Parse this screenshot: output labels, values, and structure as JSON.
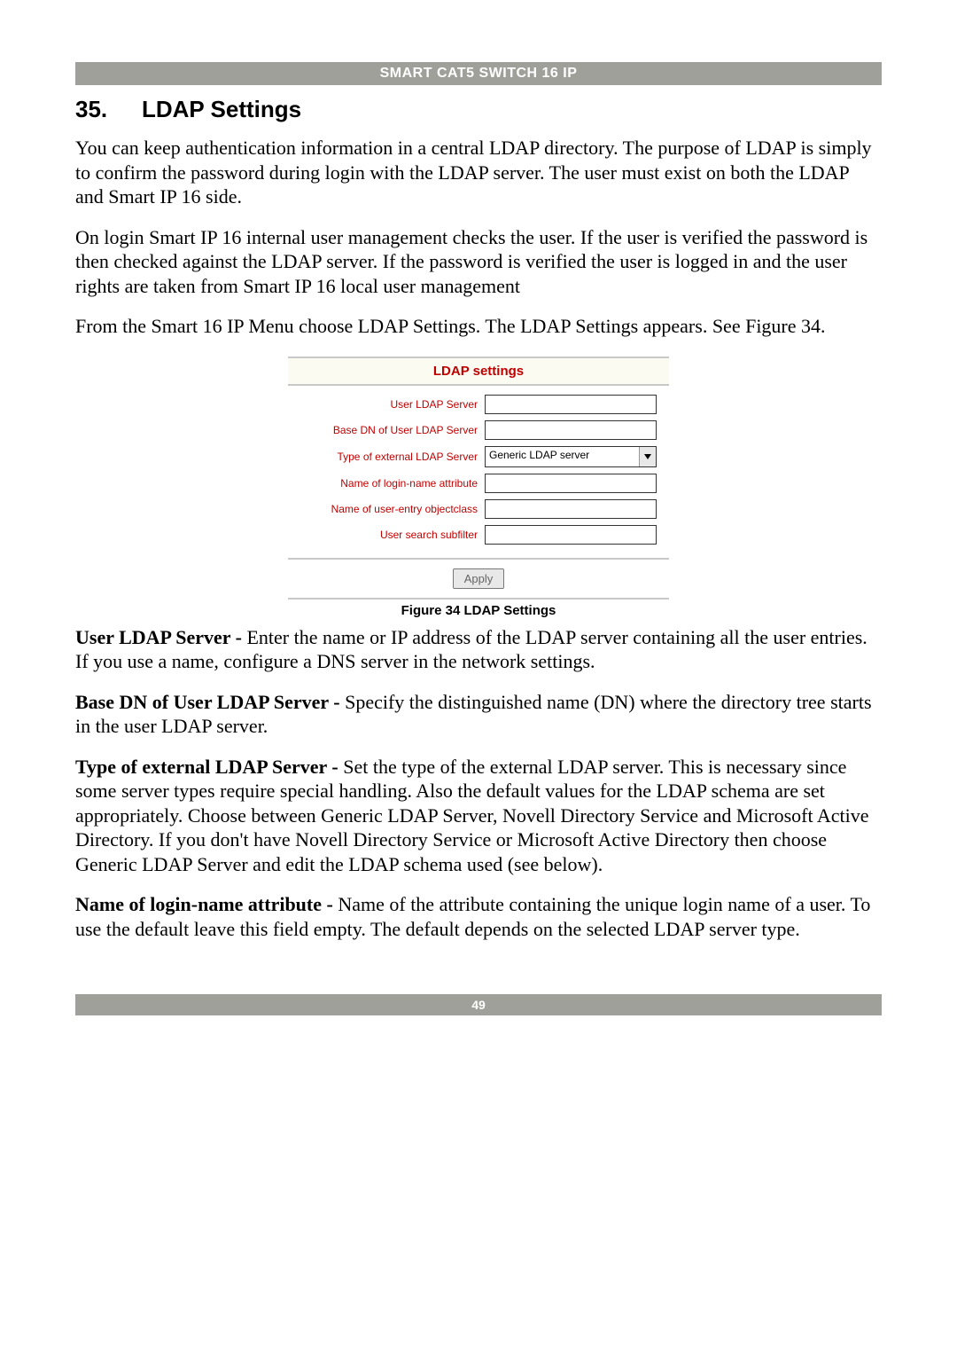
{
  "header": {
    "title": "SMART CAT5 SWITCH 16 IP"
  },
  "section": {
    "number": "35.",
    "title": "LDAP Settings"
  },
  "body": {
    "p1": "You can keep authentication information in a central LDAP directory. The purpose of LDAP is simply to confirm the password during login with the LDAP server. The user must exist on both the LDAP and Smart IP 16 side.",
    "p2": "On login Smart IP 16 internal user management checks the user. If the user is verified the password is then checked against the LDAP server. If the password is verified the user is logged in and the user rights are taken from Smart IP 16 local user management",
    "p3": "From the Smart 16 IP Menu choose LDAP Settings. The LDAP Settings appears. See Figure 34."
  },
  "figure": {
    "panel_title": "LDAP settings",
    "rows": {
      "r0": {
        "label": "User LDAP Server",
        "value": ""
      },
      "r1": {
        "label": "Base DN of User LDAP Server",
        "value": ""
      },
      "r2": {
        "label": "Type of external LDAP Server",
        "value": "Generic LDAP server"
      },
      "r3": {
        "label": "Name of login-name attribute",
        "value": ""
      },
      "r4": {
        "label": "Name of user-entry objectclass",
        "value": ""
      },
      "r5": {
        "label": "User search subfilter",
        "value": ""
      }
    },
    "apply": "Apply",
    "caption": "Figure 34 LDAP Settings"
  },
  "defs": {
    "d1_term": "User LDAP Server - ",
    "d1_text": "Enter the name or IP address of the LDAP server containing all the user entries. If you use a name, configure a DNS server in the network settings.",
    "d2_term": "Base DN of User LDAP Server - ",
    "d2_text": "Specify the distinguished name (DN) where the directory tree starts in the user LDAP server.",
    "d3_term": "Type of external LDAP Server - ",
    "d3_text": "Set the type of the external LDAP server. This is necessary since some server types require special handling. Also the default values for the LDAP schema are set appropriately. Choose between Generic LDAP Server, Novell Directory Service and Microsoft Active Directory. If you don't have Novell Directory Service or Microsoft Active Directory then choose Generic LDAP Server and edit the LDAP schema used (see below).",
    "d4_term": "Name of login-name attribute - ",
    "d4_text": "Name of the attribute containing the unique login name of a user. To use the default leave this field empty. The default depends on the selected LDAP server type."
  },
  "footer": {
    "page": "49"
  }
}
